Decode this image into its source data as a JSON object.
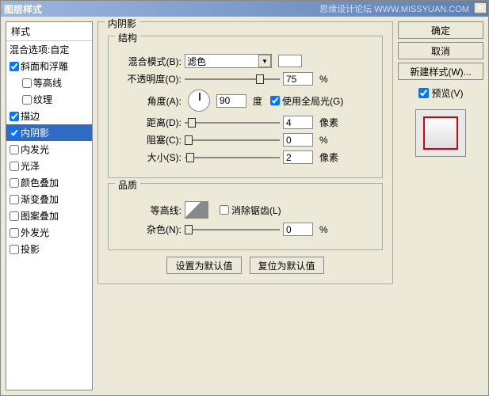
{
  "title": "图层样式",
  "watermark": "思缘设计论坛  WWW.MISSYUAN.COM",
  "sidebar": {
    "header": "样式",
    "blend": "混合选项:自定",
    "items": [
      {
        "label": "斜面和浮雕",
        "checked": true,
        "indent": false
      },
      {
        "label": "等高线",
        "checked": false,
        "indent": true
      },
      {
        "label": "纹理",
        "checked": false,
        "indent": true
      },
      {
        "label": "描边",
        "checked": true,
        "indent": false
      },
      {
        "label": "内阴影",
        "checked": true,
        "indent": false,
        "selected": true
      },
      {
        "label": "内发光",
        "checked": false,
        "indent": false
      },
      {
        "label": "光泽",
        "checked": false,
        "indent": false
      },
      {
        "label": "颜色叠加",
        "checked": false,
        "indent": false
      },
      {
        "label": "渐变叠加",
        "checked": false,
        "indent": false
      },
      {
        "label": "图案叠加",
        "checked": false,
        "indent": false
      },
      {
        "label": "外发光",
        "checked": false,
        "indent": false
      },
      {
        "label": "投影",
        "checked": false,
        "indent": false
      }
    ]
  },
  "panel": {
    "title": "内阴影",
    "struct": {
      "title": "结构",
      "blendMode": {
        "label": "混合模式(B):",
        "value": "滤色"
      },
      "opacity": {
        "label": "不透明度(O):",
        "value": "75",
        "unit": "%"
      },
      "angle": {
        "label": "角度(A):",
        "value": "90",
        "unit": "度"
      },
      "globalLight": {
        "label": "使用全局光(G)",
        "checked": true
      },
      "distance": {
        "label": "距离(D):",
        "value": "4",
        "unit": "像素"
      },
      "choke": {
        "label": "阻塞(C):",
        "value": "0",
        "unit": "%"
      },
      "size": {
        "label": "大小(S):",
        "value": "2",
        "unit": "像素"
      }
    },
    "quality": {
      "title": "品质",
      "contour": {
        "label": "等高线:"
      },
      "antialias": {
        "label": "消除锯齿(L)",
        "checked": false
      },
      "noise": {
        "label": "杂色(N):",
        "value": "0",
        "unit": "%"
      }
    },
    "buttons": {
      "default": "设置为默认值",
      "reset": "复位为默认值"
    }
  },
  "right": {
    "ok": "确定",
    "cancel": "取消",
    "newStyle": "新建样式(W)...",
    "preview": {
      "label": "预览(V)",
      "checked": true
    }
  }
}
